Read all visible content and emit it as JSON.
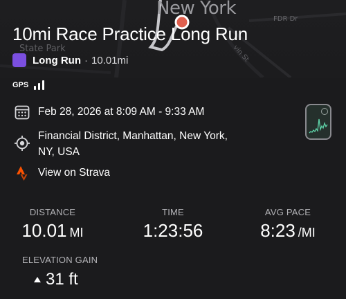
{
  "map": {
    "city_label": "New York",
    "park_label": "State Park",
    "road_label": "FDR Dr",
    "street_label": "vin St"
  },
  "activity": {
    "title": "10mi Race Practice Long Run",
    "type": "Long Run",
    "separator": "·",
    "distance_short": "10.01mi",
    "type_color": "#7b4fe0"
  },
  "gps": {
    "label": "GPS",
    "bars": 3
  },
  "info": {
    "date_range": "Feb 28, 2026 at 8:09 AM - 9:33 AM",
    "location": "Financial District, Manhattan, New York, NY, USA",
    "strava_link": "View on Strava"
  },
  "stats": {
    "distance": {
      "label": "DISTANCE",
      "value": "10.01",
      "unit": "MI"
    },
    "time": {
      "label": "TIME",
      "value": "1:23:56"
    },
    "pace": {
      "label": "AVG PACE",
      "value": "8:23",
      "unit": "/MI"
    },
    "elevation": {
      "label": "ELEVATION GAIN",
      "value": "31 ft"
    }
  },
  "colors": {
    "background": "#1b1b1d",
    "strava_orange": "#fc5200",
    "marker_red": "#e0604f",
    "chart_green": "#5fd3a8"
  }
}
